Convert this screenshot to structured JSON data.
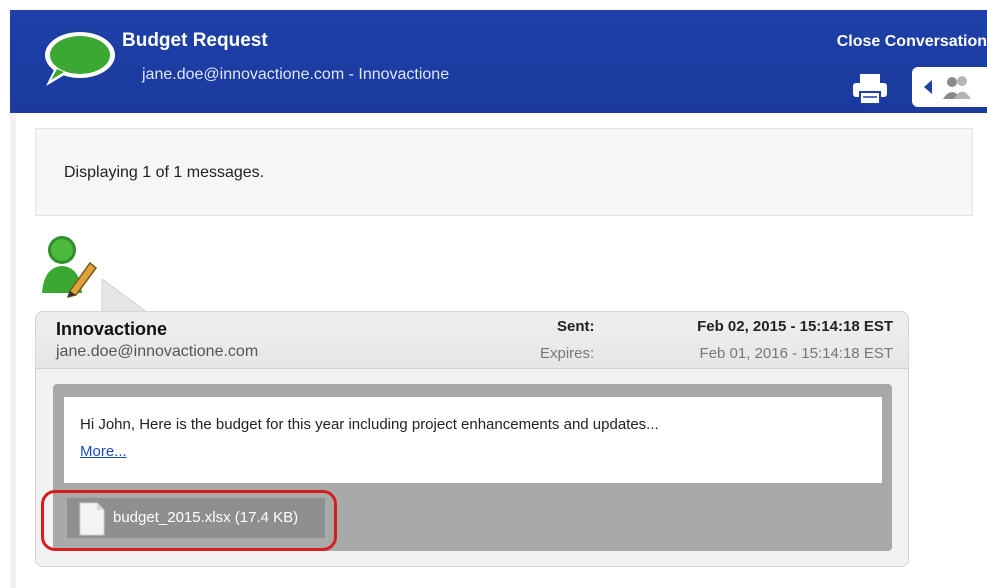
{
  "header": {
    "title": "Budget Request",
    "subtitle": "jane.doe@innovactione.com - Innovactione",
    "close_label": "Close Conversation",
    "icons": [
      "chat-bubble-icon",
      "printer-icon",
      "back-arrow-icon",
      "people-icon"
    ]
  },
  "info_bar": {
    "text": "Displaying 1 of 1 messages."
  },
  "message": {
    "sender_name": "Innovactione",
    "sender_email": "jane.doe@innovactione.com",
    "sent_label": "Sent:",
    "sent_value": "Feb 02, 2015 - 15:14:18 EST",
    "expires_label": "Expires:",
    "expires_value": "Feb 01, 2016 - 15:14:18 EST",
    "body": "Hi John,  Here is the budget for this year including project enhancements and updates...",
    "more_label": "More...",
    "attachment": "budget_2015.xlsx (17.4 KB)"
  },
  "colors": {
    "header_blue": "#1e40a8",
    "bubble_green": "#3aa832",
    "highlight_red": "#d41f1f",
    "link_blue": "#1a4cc4"
  }
}
